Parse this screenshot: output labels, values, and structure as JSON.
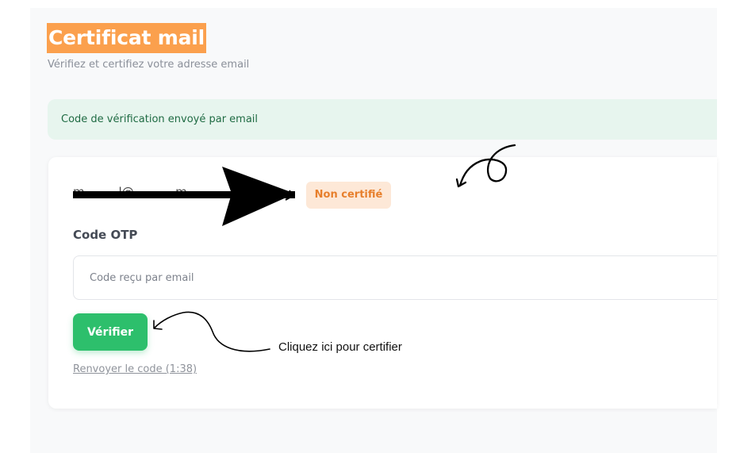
{
  "header": {
    "title": "Certificat mail",
    "subtitle": "Vérifiez et certifiez votre adresse email"
  },
  "alert": {
    "message": "Code de vérification envoyé par email"
  },
  "card": {
    "email": "m.........l@...........m",
    "status_badge": "Non certifié",
    "otp_label": "Code OTP",
    "otp_input": {
      "value": "",
      "placeholder": "Code reçu par email"
    },
    "verify_button": "Vérifier",
    "resend_link": "Renvoyer le code (1:38)"
  },
  "annotations": {
    "callout": "Cliquez ici pour certifier"
  },
  "colors": {
    "title_highlight": "#fba04d",
    "success_bg": "#e7f5ee",
    "button_green": "#2dbf6c",
    "badge_orange": "#e77f2c"
  }
}
